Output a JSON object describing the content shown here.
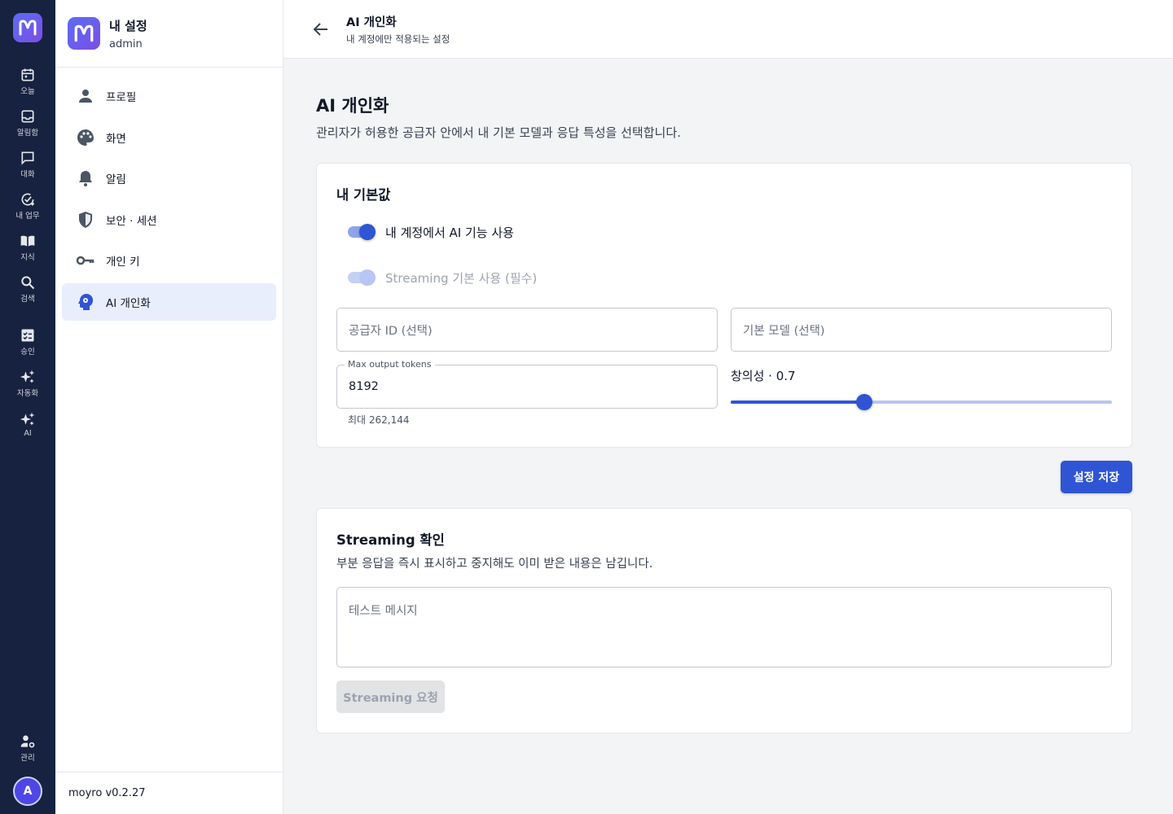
{
  "rail": {
    "items": [
      {
        "label": "오늘",
        "icon": "calendar-icon"
      },
      {
        "label": "알림함",
        "icon": "inbox-icon"
      },
      {
        "label": "대화",
        "icon": "chat-icon"
      },
      {
        "label": "내 업무",
        "icon": "task-check-icon"
      },
      {
        "label": "지식",
        "icon": "book-icon"
      },
      {
        "label": "검색",
        "icon": "search-icon"
      }
    ],
    "items2": [
      {
        "label": "승인",
        "icon": "approval-icon"
      },
      {
        "label": "자동화",
        "icon": "sparkle-icon"
      },
      {
        "label": "AI",
        "icon": "sparkle-icon"
      }
    ],
    "admin_label": "관리",
    "avatar": "A"
  },
  "sidebar": {
    "title": "내 설정",
    "subtitle": "admin",
    "items": [
      {
        "label": "프로필",
        "icon": "person-icon"
      },
      {
        "label": "화면",
        "icon": "palette-icon"
      },
      {
        "label": "알림",
        "icon": "bell-icon"
      },
      {
        "label": "보안 · 세션",
        "icon": "shield-icon"
      },
      {
        "label": "개인 키",
        "icon": "key-icon"
      },
      {
        "label": "AI 개인화",
        "icon": "ai-head-icon",
        "active": true
      }
    ],
    "footer": "moyro v0.2.27"
  },
  "topbar": {
    "title": "AI 개인화",
    "subtitle": "내 계정에만 적용되는 설정"
  },
  "main": {
    "title": "AI 개인화",
    "description": "관리자가 허용한 공급자 안에서 내 기본 모델과 응답 특성을 선택합니다.",
    "defaults_card": {
      "title": "내 기본값",
      "toggle_ai": {
        "label": "내 계정에서 AI 기능 사용",
        "on": true
      },
      "toggle_streaming": {
        "label": "Streaming 기본 사용 (필수)",
        "on": true,
        "disabled": true
      },
      "provider_placeholder": "공급자 ID (선택)",
      "model_placeholder": "기본 모델 (선택)",
      "max_tokens": {
        "label": "Max output tokens",
        "value": "8192",
        "helper": "최대 262,144"
      },
      "creativity": {
        "label": "창의성 · 0.7",
        "value": 0.7,
        "min": 0,
        "max": 2
      }
    },
    "save_button": "설정 저장",
    "streaming_card": {
      "title": "Streaming 확인",
      "description": "부분 응답을 즉시 표시하고 중지해도 이미 받은 내용은 남깁니다.",
      "textarea_placeholder": "테스트 메시지",
      "button": "Streaming 요청"
    }
  },
  "colors": {
    "rail_bg": "#172240",
    "accent": "#2f55d4",
    "active_menu_bg": "#e8eefc"
  }
}
